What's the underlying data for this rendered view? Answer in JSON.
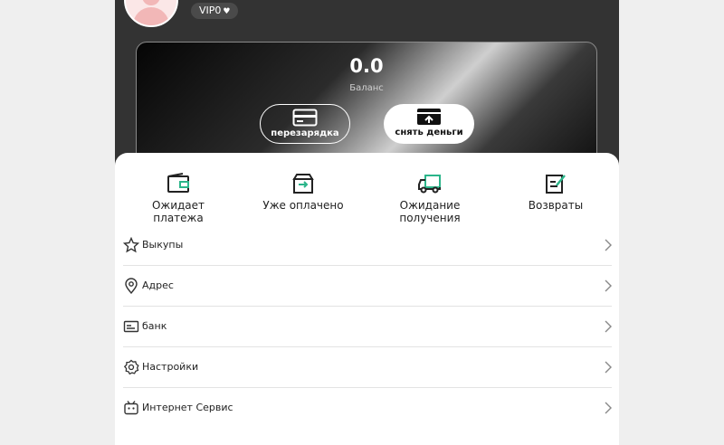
{
  "profile": {
    "vip_label": "VIP0",
    "vip_icon": "heart-icon"
  },
  "wallet": {
    "balance": "0.0",
    "balance_label": "Баланс",
    "recharge_label": "перезарядка",
    "withdraw_label": "снять деньги"
  },
  "orders": [
    {
      "label": "Ожидает платежа",
      "icon": "wallet-icon"
    },
    {
      "label": "Уже оплачено",
      "icon": "box-icon"
    },
    {
      "label": "Ожидание получения",
      "icon": "truck-icon"
    },
    {
      "label": "Возвраты",
      "icon": "edit-icon"
    }
  ],
  "menu": [
    {
      "label": "Выкупы",
      "icon": "star-icon"
    },
    {
      "label": "Адрес",
      "icon": "location-icon"
    },
    {
      "label": "банк",
      "icon": "bank-card-icon"
    },
    {
      "label": "Настройки",
      "icon": "gear-icon"
    },
    {
      "label": "Интернет Сервис",
      "icon": "robot-icon"
    }
  ],
  "colors": {
    "accent": "#2bb58a",
    "header": "#333333"
  }
}
